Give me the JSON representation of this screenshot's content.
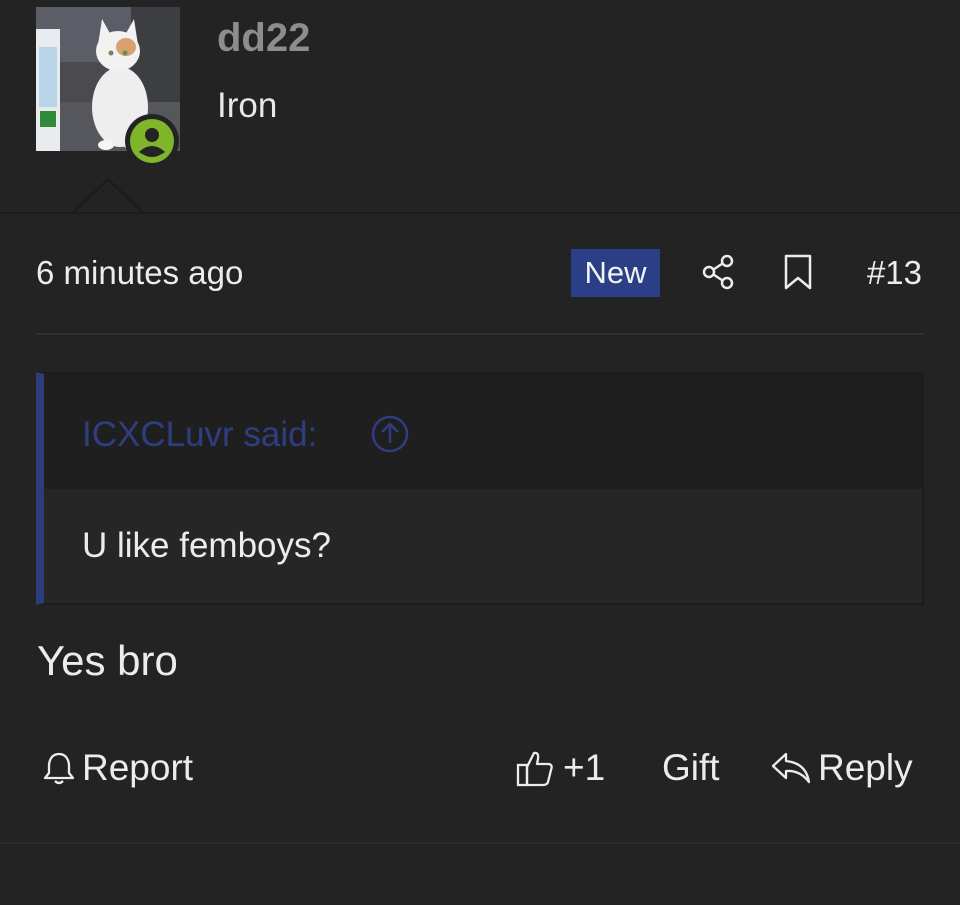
{
  "user": {
    "username": "dd22",
    "title": "Iron",
    "avatar": "cat-photo-avatar",
    "online_icon": "user-online-icon"
  },
  "message": {
    "timestamp": "6 minutes ago",
    "new_badge": "New",
    "post_number": "#13",
    "share_icon": "share-icon",
    "bookmark_icon": "bookmark-icon",
    "quote": {
      "author_label": "ICXCLuvr said:",
      "text": "U like femboys?",
      "jump_icon": "arrow-circle-up-icon"
    },
    "body": "Yes bro"
  },
  "actions": {
    "report": "Report",
    "like": "+1",
    "gift": "Gift",
    "reply": "Reply"
  },
  "colors": {
    "background": "#232323",
    "accent_blue": "#2a3f86",
    "online_green": "#7fb52a",
    "username_gray": "#8d8d8d"
  }
}
